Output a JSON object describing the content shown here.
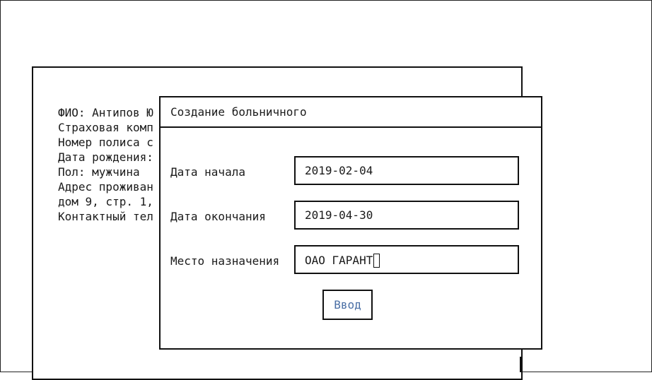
{
  "patient_info": {
    "lines": [
      "ФИО: Антипов Ю",
      "Страховая комп",
      "Номер полиса с",
      "Дата рождения:",
      "Пол: мужчина",
      "Адрес проживан",
      "дом 9, стр. 1,",
      "Контактный тел"
    ]
  },
  "dialog": {
    "title": "Создание больничного",
    "start_date": {
      "label": "Дата начала",
      "value": "2019-02-04"
    },
    "end_date": {
      "label": "Дата окончания",
      "value": "2019-04-30"
    },
    "place": {
      "label": "Место назначения",
      "value": "ОАО ГАРАНТ"
    },
    "submit_label": "Ввод"
  },
  "colors": {
    "submit_text": "#4a6fa5",
    "border": "#111111",
    "background": "#ffffff"
  }
}
